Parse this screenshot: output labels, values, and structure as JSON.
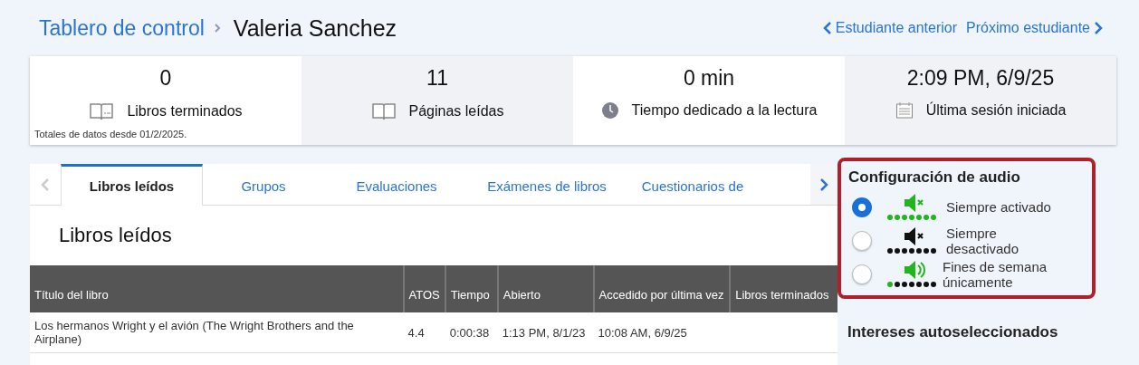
{
  "breadcrumb": {
    "parent": "Tablero de control",
    "current": "Valeria Sanchez"
  },
  "nav": {
    "previous": "Estudiante anterior",
    "next": "Próximo estudiante"
  },
  "stats": [
    {
      "kind": "book-fin",
      "value": "0",
      "label": "Libros terminados"
    },
    {
      "kind": "book",
      "value": "11",
      "label": "Páginas leídas"
    },
    {
      "kind": "clock",
      "value": "0 min",
      "label": "Tiempo dedicado a la lectura"
    },
    {
      "kind": "calendar",
      "value": "2:09 PM, 6/9/25",
      "label": "Última sesión iniciada"
    }
  ],
  "stats_note": "Totales de datos desde 01/2/2025.",
  "tabs": [
    {
      "label": "Libros leídos",
      "selected": true
    },
    {
      "label": "Grupos",
      "selected": false
    },
    {
      "label": "Evaluaciones",
      "selected": false
    },
    {
      "label": "Exámenes de libros",
      "selected": false
    },
    {
      "label": "Cuestionarios de",
      "selected": false
    }
  ],
  "section_title": "Libros leídos",
  "table": {
    "columns": [
      "Título del libro",
      "ATOS",
      "Tiempo",
      "Abierto",
      "Accedido por última vez",
      "Libros terminados"
    ],
    "rows": [
      [
        "Los hermanos Wright y el avión (The Wright Brothers and the Airplane)",
        "4.4",
        "0:00:38",
        "1:13 PM, 8/1/23",
        "10:08 AM, 6/9/25",
        ""
      ]
    ]
  },
  "audio": {
    "title": "Configuración de audio",
    "options": [
      {
        "kind": "on",
        "label": "Siempre activado",
        "selected": true
      },
      {
        "kind": "off",
        "label": "Siempre desactivado",
        "selected": false
      },
      {
        "kind": "weekends",
        "label": "Fines de semana únicamente",
        "selected": false
      }
    ]
  },
  "interests_title": "Intereses autoseleccionados"
}
